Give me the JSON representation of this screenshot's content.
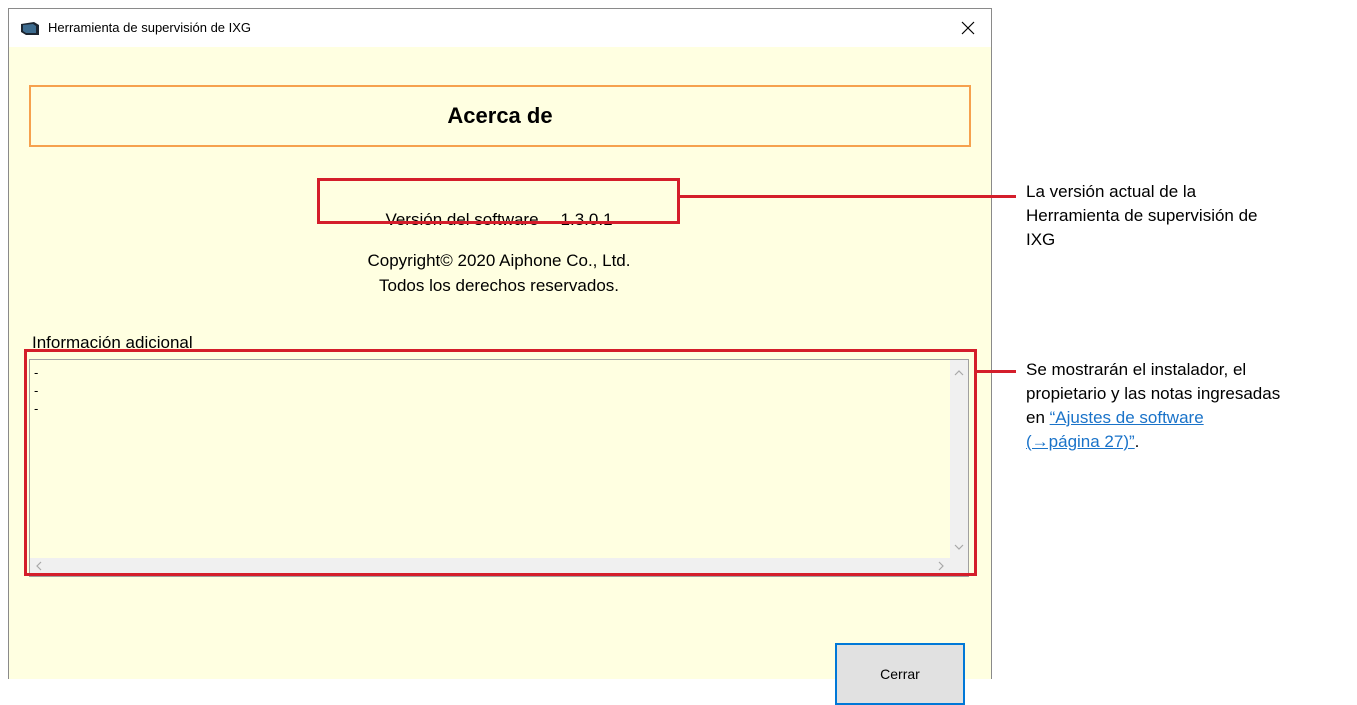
{
  "window": {
    "title": "Herramienta de supervisión de IXG",
    "close_glyph": "✕"
  },
  "dialog": {
    "header": "Acerca de",
    "version_label": "Versión del software",
    "version_value": "1.3.0.1",
    "copyright_line1": "Copyright© 2020 Aiphone Co., Ltd.",
    "copyright_line2": "Todos los derechos reservados.",
    "info_label": "Información adicional",
    "info_lines": [
      "-",
      "-",
      "-"
    ],
    "close_button": "Cerrar"
  },
  "annotations": {
    "version_note": [
      "La versión actual de la",
      "Herramienta de supervisión de",
      "IXG"
    ],
    "info_note_lines": [
      "Se mostrarán el instalador, el",
      "propietario y las notas ingresadas"
    ],
    "info_note_prefix": "en ",
    "info_note_link_1": "“Ajustes de software",
    "info_note_link_2": "(→página 27)”",
    "info_note_suffix": ".",
    "accent_color": "#d41e2b",
    "link_color": "#1a73c9"
  }
}
